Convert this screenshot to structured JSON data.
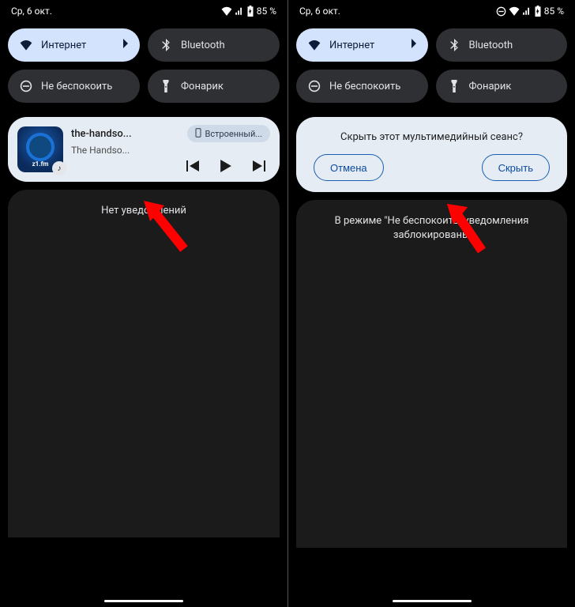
{
  "status": {
    "date": "Ср, 6 окт.",
    "battery": "85 %"
  },
  "qs": {
    "internet": "Интернет",
    "bluetooth": "Bluetooth",
    "dnd": "Не беспокоить",
    "flashlight": "Фонарик"
  },
  "media": {
    "title": "the-handso...",
    "artist": "The Handso...",
    "album_label": "z1.fm",
    "output_chip": "Встроенный..."
  },
  "dialog": {
    "text": "Скрыть этот мультимедийный сеанс?",
    "cancel": "Отмена",
    "hide": "Скрыть"
  },
  "shade": {
    "left_msg": "Нет уведомлений",
    "right_msg": "В режиме \"Не беспокоить\" уведомления заблокированы"
  }
}
